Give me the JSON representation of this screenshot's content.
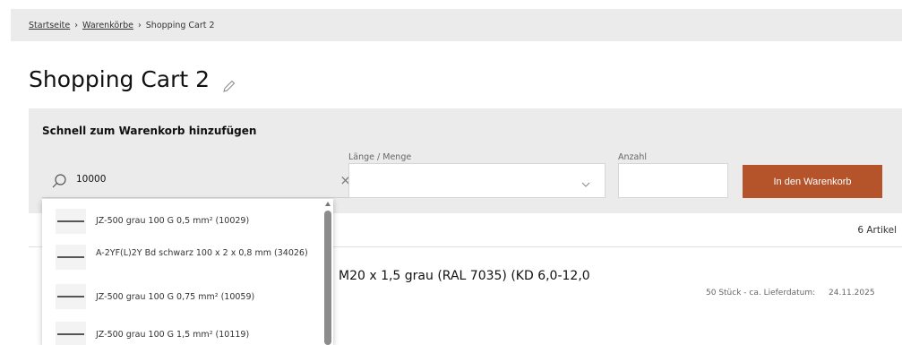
{
  "breadcrumb": {
    "items": [
      "Startseite",
      "Warenkörbe",
      "Shopping Cart 2"
    ],
    "separator": "›"
  },
  "page": {
    "title": "Shopping Cart 2"
  },
  "quick_add": {
    "title": "Schnell zum Warenkorb hinzufügen",
    "search_value": "10000",
    "length_label": "Länge / Menge",
    "quantity_label": "Anzahl",
    "add_button_label": "In den Warenkorb",
    "accent_color": "#b5532a"
  },
  "suggestions": [
    "JZ-500 grau 100 G 0,5 mm² (10029)",
    "A-2YF(L)2Y Bd schwarz 100 x 2 x 0,8 mm (34026)",
    "JZ-500 grau 100 G 0,75 mm² (10059)",
    "JZ-500 grau 100 G 1,5 mm² (10119)"
  ],
  "cart": {
    "item_count": "6 Artikel",
    "items": [
      {
        "name": "M20 x 1,5 grau (RAL 7035) (KD 6,0-12,0",
        "delivery_label": "50 Stück - ca. Lieferdatum:",
        "delivery_date": "24.11.2025"
      }
    ]
  },
  "icons": {
    "edit": "pencil-icon",
    "search": "search-icon",
    "clear": "close-icon",
    "select": "chevron-down-icon"
  }
}
